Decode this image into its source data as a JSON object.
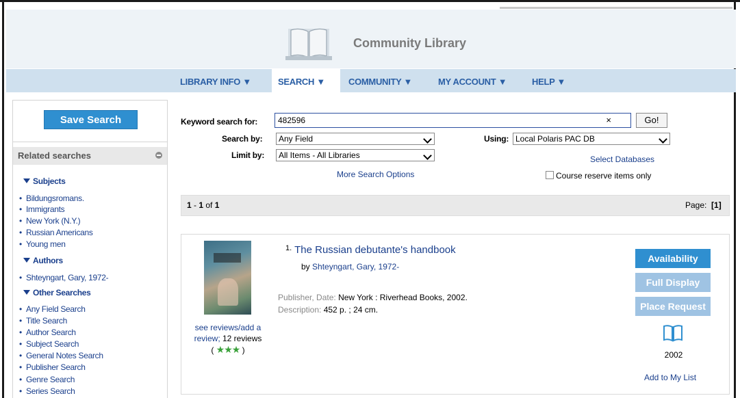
{
  "site": {
    "title": "Community Library"
  },
  "nav": {
    "items": [
      {
        "label": "LIBRARY INFO ▼"
      },
      {
        "label": "SEARCH ▼"
      },
      {
        "label": "COMMUNITY ▼"
      },
      {
        "label": "MY ACCOUNT ▼"
      },
      {
        "label": "HELP ▼"
      }
    ]
  },
  "sidebar": {
    "save_search": "Save Search",
    "related_searches": "Related searches",
    "subjects": {
      "heading": "Subjects",
      "items": [
        "Bildungsromans.",
        "Immigrants",
        "New York (N.Y.)",
        "Russian Americans",
        "Young men"
      ]
    },
    "authors": {
      "heading": "Authors",
      "items": [
        "Shteyngart, Gary, 1972-"
      ]
    },
    "other": {
      "heading": "Other Searches",
      "items": [
        "Any Field Search",
        "Title Search",
        "Author Search",
        "Subject Search",
        "General Notes Search",
        "Publisher Search",
        "Genre Search",
        "Series Search"
      ]
    }
  },
  "search": {
    "keyword_label": "Keyword search for:",
    "keyword_value": "482596",
    "clear_glyph": "×",
    "go_label": "Go!",
    "search_by_label": "Search by:",
    "search_by_value": "Any Field",
    "limit_by_label": "Limit by:",
    "limit_by_value": "All Items - All Libraries",
    "using_label": "Using:",
    "using_value": "Local Polaris PAC DB",
    "select_databases": "Select Databases",
    "more_options": "More Search Options",
    "course_reserve": "Course reserve items only"
  },
  "results": {
    "range_start": "1",
    "range_sep": " - ",
    "range_end": "1",
    "of_text": " of ",
    "total": "1",
    "page_label": "Page:",
    "page_value": "[1]"
  },
  "record": {
    "index": "1.",
    "title": "The Russian debutante's handbook",
    "by": "by",
    "author": "Shteyngart, Gary, 1972-",
    "publisher_label": "Publisher, Date:",
    "publisher_value": "New York : Riverhead Books, 2002.",
    "description_label": "Description:",
    "description_value": "452 p. ; 24 cm.",
    "reviews_line1": "see reviews/add a",
    "reviews_line2": "review;",
    "reviews_count": "12 reviews",
    "stars": "★★★",
    "rating": 3,
    "availability": "Availability",
    "full_display": "Full Display",
    "place_request": "Place Request",
    "format_icon": "book-icon",
    "year": "2002",
    "add_to_list": "Add to My List"
  },
  "colors": {
    "nav_bg": "#cfe0ee",
    "link": "#1a3f8c",
    "button_primary": "#2f8fd0",
    "button_disabled": "#9fc3e3",
    "star": "#3aa13a"
  }
}
